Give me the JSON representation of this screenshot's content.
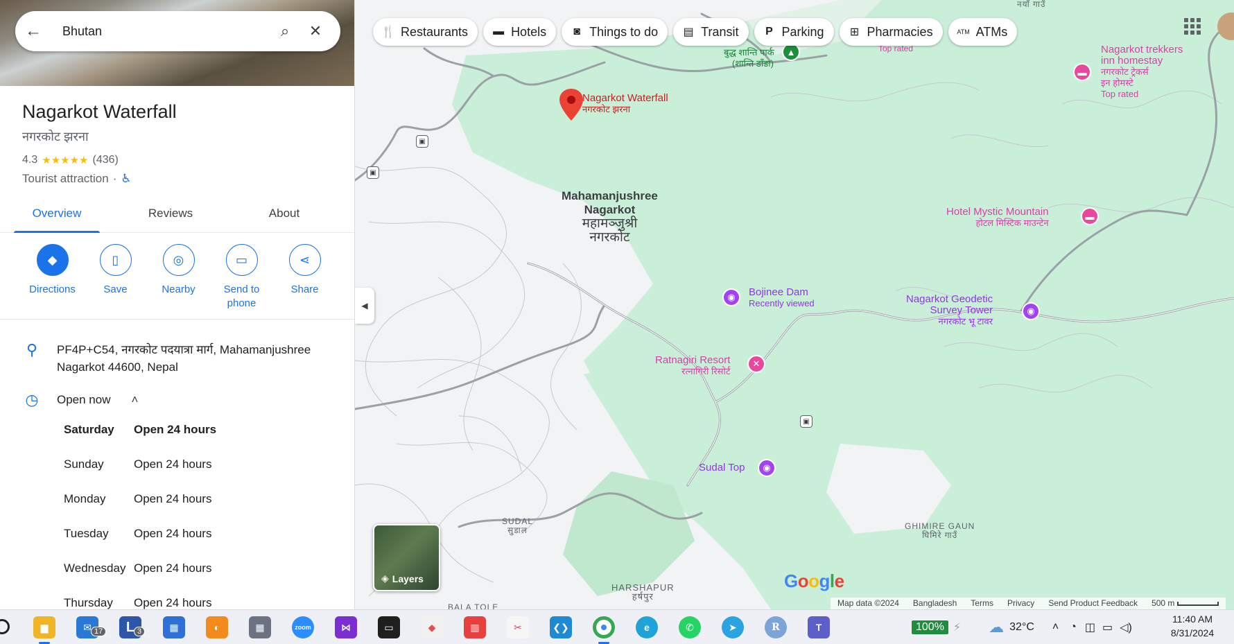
{
  "search": {
    "query": "Bhutan"
  },
  "place": {
    "name": "Nagarkot Waterfall",
    "native_name": "नगरकोट झरना",
    "rating": "4.3",
    "stars": "★★★★★",
    "review_count": "(436)",
    "category": "Tourist attraction",
    "separator": "·"
  },
  "tabs": [
    {
      "label": "Overview"
    },
    {
      "label": "Reviews"
    },
    {
      "label": "About"
    }
  ],
  "actions": [
    {
      "label": "Directions",
      "icon": "directions-icon"
    },
    {
      "label": "Save",
      "icon": "bookmark-icon"
    },
    {
      "label": "Nearby",
      "icon": "nearby-icon"
    },
    {
      "label": "Send to phone",
      "icon": "send-to-phone-icon"
    },
    {
      "label": "Share",
      "icon": "share-icon"
    }
  ],
  "address": "PF4P+C54, नगरकोट पदयात्रा मार्ग, Mahamanjushree Nagarkot 44600, Nepal",
  "open_status": "Open now",
  "hours": [
    {
      "day": "Saturday",
      "time": "Open 24 hours"
    },
    {
      "day": "Sunday",
      "time": "Open 24 hours"
    },
    {
      "day": "Monday",
      "time": "Open 24 hours"
    },
    {
      "day": "Tuesday",
      "time": "Open 24 hours"
    },
    {
      "day": "Wednesday",
      "time": "Open 24 hours"
    },
    {
      "day": "Thursday",
      "time": "Open 24 hours"
    }
  ],
  "chips": [
    {
      "label": "Restaurants",
      "icon": "restaurant-icon"
    },
    {
      "label": "Hotels",
      "icon": "hotel-icon"
    },
    {
      "label": "Things to do",
      "icon": "camera-icon"
    },
    {
      "label": "Transit",
      "icon": "transit-icon"
    },
    {
      "label": "Parking",
      "icon": "parking-icon"
    },
    {
      "label": "Pharmacies",
      "icon": "pharmacy-icon"
    },
    {
      "label": "ATMs",
      "icon": "atm-icon"
    }
  ],
  "map_labels": {
    "waterfall": {
      "name": "Nagarkot Waterfall",
      "sub": "नगरकोट झरना"
    },
    "town": {
      "name1": "Mahamanjushree",
      "name2": "Nagarkot",
      "hi1": "महामञ्जुश्री",
      "hi2": "नगरकोट"
    },
    "bojinee": {
      "name": "Bojinee Dam",
      "sub": "Recently viewed"
    },
    "ratnagiri": {
      "name": "Ratnagiri Resort",
      "sub": "रत्नागिरी रिसोर्ट"
    },
    "sudal_top": {
      "name": "Sudal Top"
    },
    "hotel_mystic": {
      "name": "Hotel Mystic Mountain",
      "sub": "होटल मिस्टिक माउन्टेन"
    },
    "geodetic": {
      "name1": "Nagarkot Geodetic",
      "name2": "Survey Tower",
      "sub": "नगरकोट भू टावर"
    },
    "trekkers": {
      "name1": "Nagarkot trekkers",
      "name2": "inn homestay",
      "sub1": "नगरकोट ट्रेकर्स",
      "sub2": "इन होमस्टे",
      "sub3": "Top rated"
    },
    "buddha_park": {
      "name": "बुद्ध शान्ति पार्क",
      "sub": "(शान्ति डाँडा)"
    },
    "top_rated_partial": {
      "name": "Top rated"
    },
    "sudal": {
      "name": "SUDAL",
      "sub": "सुडाल"
    },
    "ghimire": {
      "name": "GHIMIRE GAUN",
      "sub": "घिमिरे गाउँ"
    },
    "harshapur": {
      "name": "HARSHAPUR",
      "sub": "हर्षपुर"
    },
    "bala_tole": {
      "name": "BALA TOLE"
    },
    "top_partial": {
      "name": "नयाँ गाउँ"
    }
  },
  "layers_label": "Layers",
  "google_logo": "Google",
  "attribution": {
    "map_data": "Map data ©2024",
    "country": "Bangladesh",
    "terms": "Terms",
    "privacy": "Privacy",
    "feedback": "Send Product Feedback",
    "scale": "500 m"
  },
  "taskbar": {
    "mail_badge": "17",
    "l_badge": "3",
    "zoom_label": "zoom",
    "battery": "100%",
    "temperature": "32°C",
    "time": "11:40 AM",
    "date": "8/31/2024"
  },
  "colors": {
    "accent": "#1a73e8",
    "park_green": "#c9efd9",
    "marker_red": "#ea4335",
    "poi_pink": "#e8499e",
    "poi_purple": "#a142f4"
  }
}
